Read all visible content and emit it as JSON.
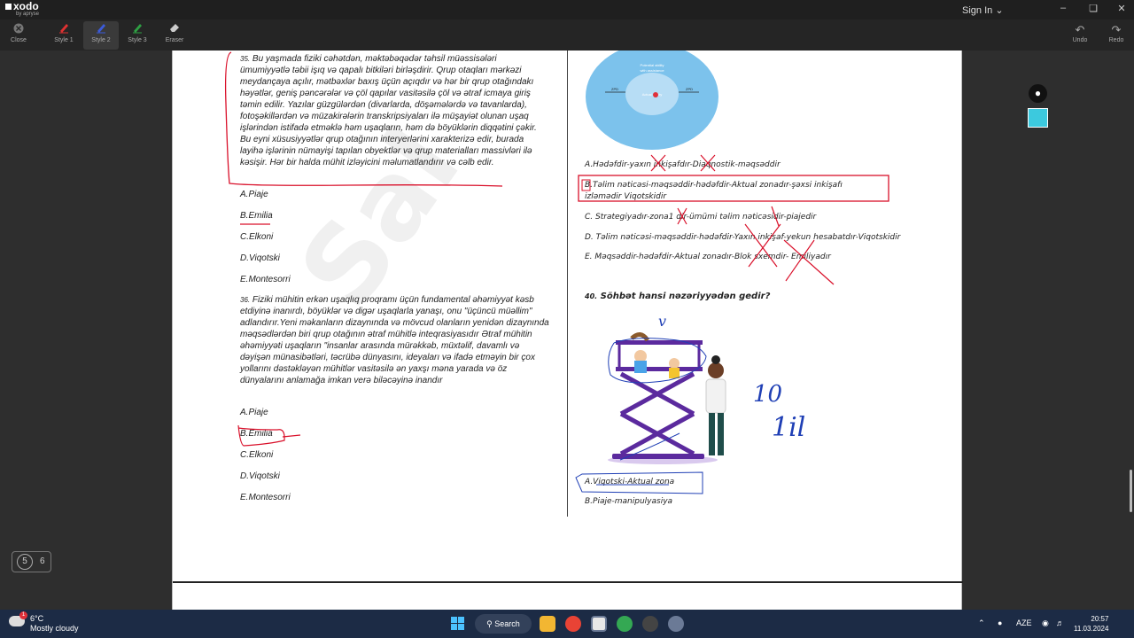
{
  "app": {
    "name": "xodo",
    "subtitle": "by apryse",
    "sign_in": "Sign In"
  },
  "toolbar": {
    "tools": [
      {
        "label": "Close",
        "icon": "close-icon"
      },
      {
        "label": "Style 1",
        "icon": "pen-icon",
        "color": "#e03131"
      },
      {
        "label": "Style 2",
        "icon": "pen-icon",
        "color": "#1e40c8"
      },
      {
        "label": "Style 3",
        "icon": "pen-icon",
        "color": "#2ea043"
      },
      {
        "label": "Eraser",
        "icon": "eraser-icon"
      }
    ],
    "undo": "Undo",
    "redo": "Redo"
  },
  "left": {
    "q35": {
      "number": "35.",
      "text": "Bu yaşmada  fiziki cəhətdən, məktəbəqədər təhsil müəssisələri ümumiyyətlə təbii işıq və qapalı bitkiləri birləşdirir. Qrup otaqları mərkəzi meydançaya açılır, mətbəxlər baxış üçün açıqdır və hər bir qrup otağındakı həyətlər, geniş pəncərələr və çöl qapılar vasitəsilə çöl və ətraf icmaya giriş təmin edilir. Yazılar güzgülərdən (divarlarda, döşəmələrdə və tavanlarda), fotoşəkillərdən və müzakirələrin transkripsiyaları ilə müşayiət olunan uşaq işlərindən istifadə etməklə həm uşaqların, həm də böyüklərin diqqətini çəkir. Bu eyni xüsusiyyətlər qrup otağının interyerlərini xarakterizə edir, burada layihə işlərinin nümayişi tapılan obyektlər və qrup materialları massivləri ilə kəsişir. Hər bir halda mühit izləyicini məlumatlandırır və cəlb edir.",
      "options": [
        "A.Piaje",
        "B.Emilia",
        "C.Elkoni",
        "D.Viqotski",
        "E.Montesorri"
      ]
    },
    "q36": {
      "number": "36.",
      "text": "Fiziki mühitin erkən uşaqlıq proqramı üçün fundamental əhəmiyyət kəsb etdiyinə inanırdı, böyüklər və digər uşaqlarla yanaşı, onu \"üçüncü müəllim\" adlandırır.Yeni məkanların dizaynında və mövcud olanların yenidən dizaynında məqsədlərdən biri qrup otağının ətraf mühitlə inteqrasiyasıdır Ətraf mühitin əhəmiyyəti uşaqların \"insanlar arasında mürəkkəb, müxtəlif, davamlı və dəyişən münasibətləri, təcrübə dünyasını, ideyaları və ifadə etməyin bir çox yollarını dəstəkləyən mühitlər vasitəsilə ən yaxşı məna yarada və öz dünyalarını anlamağa imkan verə biləcəyinə inandır",
      "options": [
        "A.Piaje",
        "B.Emilia",
        "C.Elkoni",
        "D.Viqotski",
        "E.Montesorri"
      ]
    }
  },
  "right": {
    "diagram": {
      "outer_label": "Potential ability\nwith assistance",
      "inner_label": "Actual ability",
      "zpd_left": "ZPD",
      "zpd_right": "ZPD"
    },
    "q39_options": [
      "A.Hədəfdir-yaxın  inkişafdır-Diaqnostik-məqsəddir",
      "B.Təlim nəticəsi-məqsəddir-hədəfdir-Aktual zonadır-şəxsi inkişafı izləmədir Viqotskidir",
      "C. Strategiyadır-zona1 dir-ümümi təlim nəticəsidir-piajedir",
      "D.  Təlim nəticəsi-məqsəddir-hədəfdir-Yaxın inkişaf-yekun hesabatdır-Viqotskidir",
      "E.  Məqsəddir-hədəfdir-Aktual zonadır-Blok sxemdir- Emiliyadır"
    ],
    "q40": {
      "number": "40.",
      "text": "Söhbət hansi nəzəriyyədən gedir?",
      "options": [
        "A.Viqotski-Aktual zona",
        "B.Piaje-manipulyasiya"
      ]
    },
    "handwriting": {
      "check": "v",
      "ten": "10",
      "word": "1il"
    }
  },
  "page_indicator": {
    "current": "5",
    "total": "6"
  },
  "taskbar": {
    "weather_temp": "6°C",
    "weather_cond": "Mostly cloudy",
    "weather_badge": "1",
    "search": "Search",
    "lang": "AZE",
    "time": "20:57",
    "date": "11.03.2024"
  },
  "colors": {
    "accent_red": "#d9102a",
    "ink_blue": "#1f3fb5",
    "diagram_blue": "#7cc2ec"
  }
}
